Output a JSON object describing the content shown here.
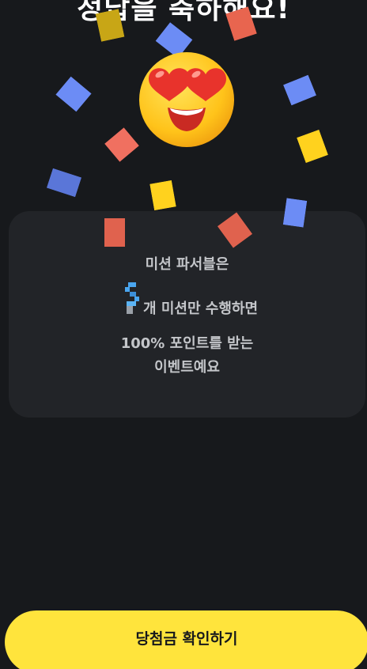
{
  "headline": "정답을 축하해요!",
  "emoji": {
    "icon": "heart-eyes-emoji-icon"
  },
  "card": {
    "line1": "미션 파서블은",
    "mission_count_icon": "pixel-digit-icon",
    "line2": "개 미션만 수행하면",
    "line3": "100% 포인트를 받는",
    "line4": "이벤트예요"
  },
  "cta": {
    "label": "당첨금 확인하기"
  },
  "colors": {
    "background": "#17191c",
    "card": "#222428",
    "button": "#ffe43c",
    "confetti_blue": "#6c8cf5",
    "confetti_red": "#f07060",
    "confetti_yellow": "#ffd21e"
  }
}
